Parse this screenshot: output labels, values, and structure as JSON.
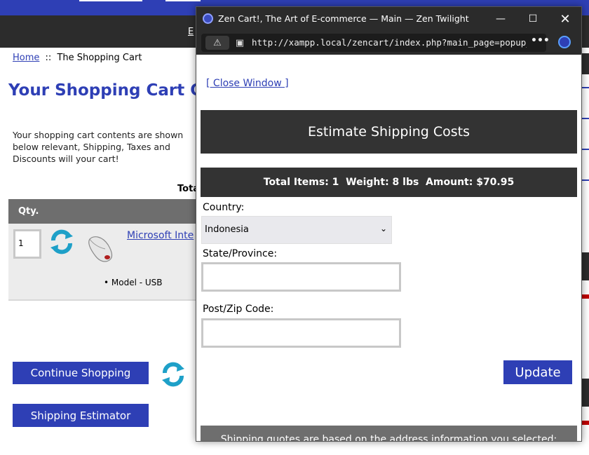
{
  "colors": {
    "brand_blue": "#2e3fb5",
    "dark_bar": "#333333",
    "grey_bar": "#6e6e6e"
  },
  "store": {
    "header_link": "E",
    "breadcrumb": {
      "home": "Home",
      "separator": "::",
      "current": "The Shopping Cart"
    },
    "title": "Your Shopping Cart Co",
    "intro": "Your shopping cart contents are shown below relevant, Shipping, Taxes and Discounts will your cart!",
    "total_label": "Tota",
    "qty_header": "Qty.",
    "item": {
      "quantity": "1",
      "product_link": "Microsoft Inte",
      "attribute": "• Model - USB"
    },
    "continue_button": "Continue Shopping",
    "estimator_button": "Shipping Estimator"
  },
  "popup": {
    "window_title": "Zen Cart!, The Art of E-commerce — Main — Zen Twilight",
    "url": "http://xampp.local/zencart/index.php?main_page=popup_",
    "close_link": "[ Close Window ]",
    "heading": "Estimate Shipping Costs",
    "totals": "Total Items: 1  Weight: 8 lbs  Amount: $70.95",
    "country_label": "Country:",
    "country_value": "Indonesia",
    "state_label": "State/Province:",
    "zip_label": "Post/Zip Code:",
    "update_button": "Update",
    "quote_note": "Shipping quotes are based on the address information you selected:"
  }
}
